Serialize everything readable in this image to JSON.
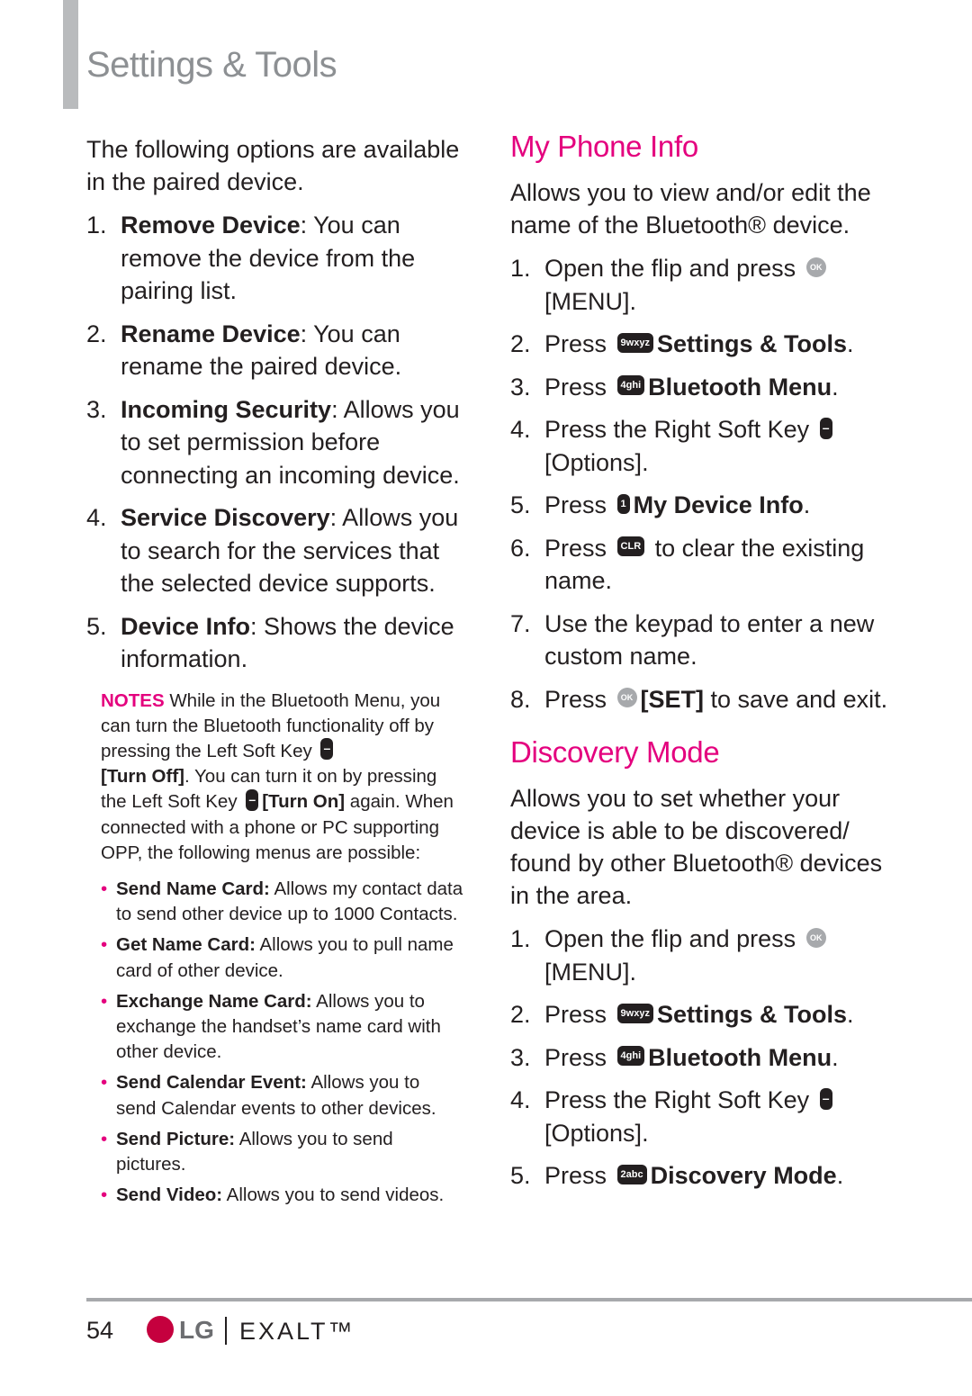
{
  "header": {
    "title": "Settings & Tools"
  },
  "left": {
    "intro": "The following options are available in the paired device.",
    "items": [
      {
        "num": "1.",
        "term": "Remove Device",
        "desc": ": You can remove the device from the pairing list."
      },
      {
        "num": "2.",
        "term": "Rename Device",
        "desc": ": You can rename the paired device."
      },
      {
        "num": "3.",
        "term": "Incoming Security",
        "desc": ": Allows you to set permission before connecting an incoming device."
      },
      {
        "num": "4.",
        "term": "Service Discovery",
        "desc": ": Allows you to search for the services that the selected device supports."
      },
      {
        "num": "5.",
        "term": "Device Info",
        "desc": ": Shows the device information."
      }
    ],
    "notes": {
      "label": "NOTES",
      "t1": " While in the Bluetooth Menu, you can turn the Bluetooth functionality off by pressing the Left Soft Key ",
      "b1": "[Turn Off]",
      "t2": ". You can turn it on by pressing the Left Soft Key ",
      "b2": "[Turn On]",
      "t3": " again. When connected with a phone or PC supporting OPP, the following menus are possible:"
    },
    "bullets": [
      {
        "term": "Send Name Card:",
        "desc": " Allows my contact data to send other device up to 1000 Contacts."
      },
      {
        "term": "Get Name Card:",
        "desc": " Allows you to pull name card of other device."
      },
      {
        "term": "Exchange Name Card:",
        "desc": " Allows you to exchange the handset’s name card with other device."
      },
      {
        "term": "Send Calendar Event:",
        "desc": " Allows you to send Calendar events to other devices."
      },
      {
        "term": "Send Picture:",
        "desc": " Allows you to send pictures."
      },
      {
        "term": "Send Video:",
        "desc": " Allows you to send videos."
      }
    ]
  },
  "my_phone_info": {
    "heading": "My Phone Info",
    "intro": "Allows you to view and/or edit the name of the Bluetooth® device.",
    "steps": {
      "s1a": "Open the flip and press ",
      "s1b": "[MENU]",
      "s2a": "Press ",
      "s2b": "Settings & Tools",
      "s3a": "Press ",
      "s3b": "Bluetooth Menu",
      "s4a": "Press the Right Soft Key ",
      "s4b": "[Options]",
      "s5a": "Press ",
      "s5b": "My Device Info",
      "s6a": "Press ",
      "s6b": " to clear the existing name.",
      "s7": "Use the keypad to enter a new custom name.",
      "s8a": "Press ",
      "s8b": "[SET]",
      "s8c": " to save and exit."
    }
  },
  "discovery_mode": {
    "heading": "Discovery Mode",
    "intro": "Allows you to set whether your device is able to be discovered/ found by other Bluetooth® devices in the area.",
    "steps": {
      "s1a": "Open the flip and press ",
      "s1b": "[MENU]",
      "s2a": "Press ",
      "s2b": "Settings & Tools",
      "s3a": "Press ",
      "s3b": "Bluetooth Menu",
      "s4a": "Press the Right Soft Key ",
      "s4b": "[Options]",
      "s5a": "Press ",
      "s5b": "Discovery Mode"
    }
  },
  "keys": {
    "ok": "OK",
    "k9": "9wxyz",
    "k4": "4ghi",
    "k1": "1",
    "k2": "2abc",
    "clr": "CLR",
    "soft": "–"
  },
  "footer": {
    "page_number": "54",
    "brand": "LG",
    "product": "EXALT™"
  }
}
